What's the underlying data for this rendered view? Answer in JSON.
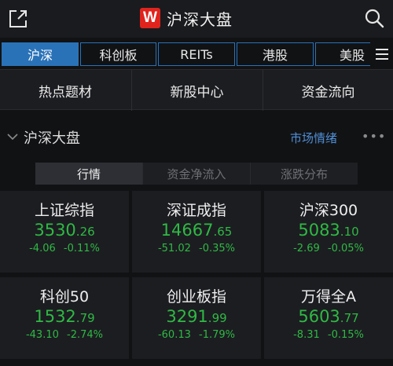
{
  "header": {
    "logo_letter": "W",
    "title": "沪深大盘",
    "share_icon": "share-icon",
    "search_icon": "search-icon"
  },
  "tabs": [
    {
      "label": "沪深",
      "active": true
    },
    {
      "label": "科创板",
      "active": false
    },
    {
      "label": "REITs",
      "active": false
    },
    {
      "label": "港股",
      "active": false
    },
    {
      "label": "美股",
      "active": false
    }
  ],
  "tab_menu_icon": "menu-icon",
  "quick_links": [
    "热点题材",
    "新股中心",
    "资金流向"
  ],
  "section": {
    "title": "沪深大盘",
    "market_mood": "市场情绪",
    "more": "•••"
  },
  "segments": [
    {
      "label": "行情",
      "active": true
    },
    {
      "label": "资金净流入",
      "active": false
    },
    {
      "label": "涨跌分布",
      "active": false
    }
  ],
  "indices": [
    {
      "name": "上证综指",
      "price_int": "3530",
      "price_dec": ".26",
      "change": "-4.06",
      "pct": "-0.11%"
    },
    {
      "name": "深证成指",
      "price_int": "14667",
      "price_dec": ".65",
      "change": "-51.02",
      "pct": "-0.35%"
    },
    {
      "name": "沪深300",
      "price_int": "5083",
      "price_dec": ".10",
      "change": "-2.69",
      "pct": "-0.05%"
    },
    {
      "name": "科创50",
      "price_int": "1532",
      "price_dec": ".79",
      "change": "-43.10",
      "pct": "-2.74%"
    },
    {
      "name": "创业板指",
      "price_int": "3291",
      "price_dec": ".99",
      "change": "-60.13",
      "pct": "-1.79%"
    },
    {
      "name": "万得全A",
      "price_int": "5603",
      "price_dec": ".77",
      "change": "-8.31",
      "pct": "-0.15%"
    }
  ],
  "colors": {
    "down": "#2fb944",
    "accent": "#2a72b8",
    "brand": "#e0241d",
    "link": "#4f8ed4"
  }
}
